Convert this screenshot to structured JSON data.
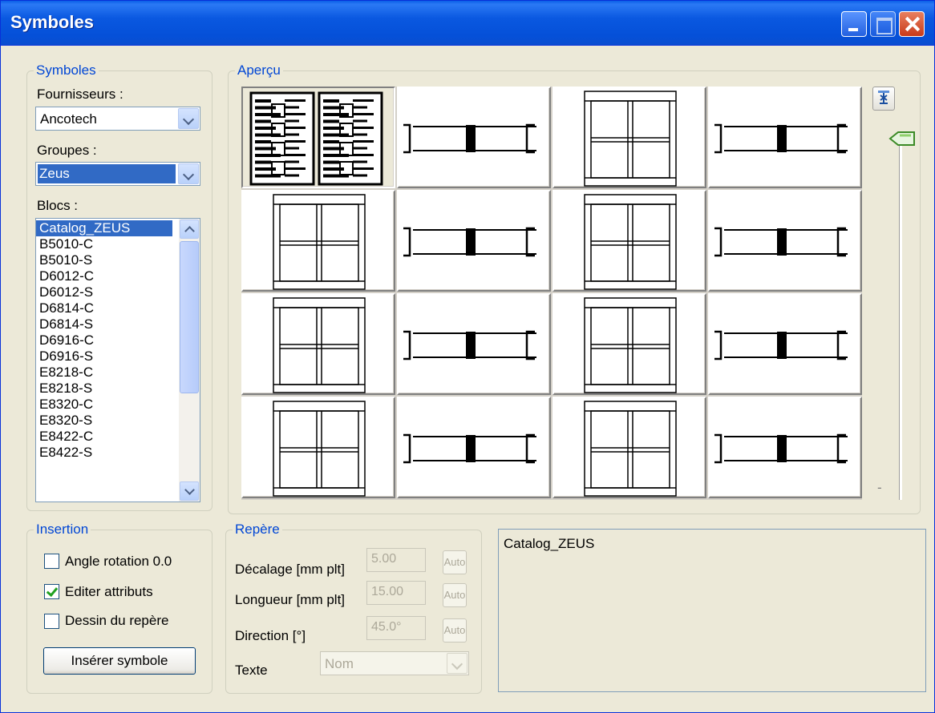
{
  "window": {
    "title": "Symboles"
  },
  "symboles_group": {
    "legend": "Symboles",
    "fournisseurs_label": "Fournisseurs :",
    "fournisseurs_value": "Ancotech",
    "groupes_label": "Groupes :",
    "groupes_value": "Zeus",
    "blocs_label": "Blocs :",
    "blocs_items": [
      "Catalog_ZEUS",
      "B5010-C",
      "B5010-S",
      "D6012-C",
      "D6012-S",
      "D6814-C",
      "D6814-S",
      "D6916-C",
      "D6916-S",
      "E8218-C",
      "E8218-S",
      "E8320-C",
      "E8320-S",
      "E8422-C",
      "E8422-S"
    ],
    "blocs_selected": "Catalog_ZEUS"
  },
  "apercu_group": {
    "legend": "Aperçu",
    "slider_min_label": "-",
    "cells": [
      "catalog",
      "beam",
      "frame",
      "beam",
      "frame",
      "beam",
      "frame",
      "beam",
      "frame",
      "beam",
      "frame",
      "beam",
      "frame",
      "beam",
      "frame",
      "beam"
    ]
  },
  "insertion_group": {
    "legend": "Insertion",
    "angle_label": "Angle rotation 0.0",
    "angle_checked": false,
    "editer_label": "Editer attributs",
    "editer_checked": true,
    "dessin_label": "Dessin du repère",
    "dessin_checked": false,
    "insert_button": "Insérer symbole"
  },
  "repere_group": {
    "legend": "Repère",
    "decalage_label": "Décalage [mm plt]",
    "decalage_value": "5.00",
    "longueur_label": "Longueur [mm plt]",
    "longueur_value": "15.00",
    "direction_label": "Direction [°]",
    "direction_value": "45.0°",
    "auto_label": "Auto",
    "texte_label": "Texte",
    "texte_value": "Nom"
  },
  "info_box": {
    "text": "Catalog_ZEUS"
  },
  "colors": {
    "titlebar": "#0a58e0",
    "selection": "#316ac5",
    "legend_text": "#0046d5",
    "window_bg": "#ece9d8"
  }
}
